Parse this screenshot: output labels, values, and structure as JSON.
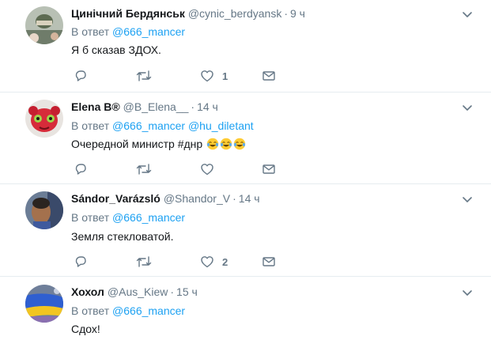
{
  "tweets": [
    {
      "name": "Цинічний Бердянськ",
      "handle": "@cynic_berdyansk",
      "time": "9 ч",
      "reply_prefix": "В ответ",
      "reply_users": [
        "@666_mancer"
      ],
      "text": "Я б сказав ЗДОХ.",
      "likes": "1"
    },
    {
      "name": "Elena B®",
      "handle": "@B_Elena__",
      "time": "14 ч",
      "reply_prefix": "В ответ",
      "reply_users": [
        "@666_mancer",
        "@hu_diletant"
      ],
      "text": "Очередной министр #днр",
      "likes": ""
    },
    {
      "name": "Sándor_Varázsló",
      "handle": "@Shandor_V",
      "time": "14 ч",
      "reply_prefix": "В ответ",
      "reply_users": [
        "@666_mancer"
      ],
      "text": "Земля стекловатой.",
      "likes": "2"
    },
    {
      "name": "Хохол",
      "handle": "@Aus_Kiew",
      "time": "15 ч",
      "reply_prefix": "В ответ",
      "reply_users": [
        "@666_mancer"
      ],
      "text": "Сдох!",
      "likes": ""
    }
  ],
  "icons": {
    "reply": "reply-icon",
    "retweet": "retweet-icon",
    "like": "heart-icon",
    "dm": "envelope-icon",
    "more": "chevron-down-icon",
    "emoji": "face-with-tears-of-joy-emoji"
  },
  "colors": {
    "link": "#1da1f2",
    "secondary": "#657786",
    "text": "#14171a",
    "divider": "#e6ecf0"
  }
}
